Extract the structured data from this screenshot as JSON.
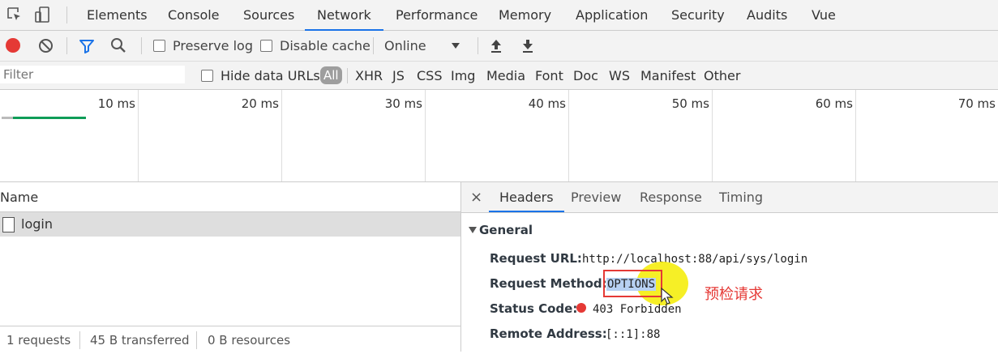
{
  "tabs": [
    {
      "label": "Elements"
    },
    {
      "label": "Console"
    },
    {
      "label": "Sources"
    },
    {
      "label": "Network"
    },
    {
      "label": "Performance"
    },
    {
      "label": "Memory"
    },
    {
      "label": "Application"
    },
    {
      "label": "Security"
    },
    {
      "label": "Audits"
    },
    {
      "label": "Vue"
    }
  ],
  "toolbar": {
    "preserve_log": "Preserve log",
    "disable_cache": "Disable cache",
    "throttle": "Online"
  },
  "filterbar": {
    "placeholder": "Filter",
    "hide_data_urls": "Hide data URLs",
    "types": [
      "All",
      "XHR",
      "JS",
      "CSS",
      "Img",
      "Media",
      "Font",
      "Doc",
      "WS",
      "Manifest",
      "Other"
    ]
  },
  "timeline": {
    "ticks": [
      "10 ms",
      "20 ms",
      "30 ms",
      "40 ms",
      "50 ms",
      "60 ms",
      "70 ms"
    ]
  },
  "requests": {
    "column_name": "Name",
    "rows": [
      {
        "name": "login"
      }
    ]
  },
  "statusbar": {
    "requests": "1 requests",
    "transferred": "45 B transferred",
    "resources": "0 B resources"
  },
  "detail": {
    "close": "×",
    "tabs": [
      "Headers",
      "Preview",
      "Response",
      "Timing"
    ],
    "section": "General",
    "fields": [
      {
        "label": "Request URL:",
        "value": "http://localhost:88/api/sys/login"
      },
      {
        "label": "Request Method:",
        "value": "OPTIONS"
      },
      {
        "label": "Status Code:",
        "value": "403 Forbidden"
      },
      {
        "label": "Remote Address:",
        "value": "[::1]:88"
      }
    ],
    "annotation": "预检请求"
  },
  "colors": {
    "accent": "#1a73e8",
    "record": "#e53935",
    "filter_icon": "#1a73e8",
    "annotation": "#e53935",
    "highlight": "#f5ec00"
  }
}
